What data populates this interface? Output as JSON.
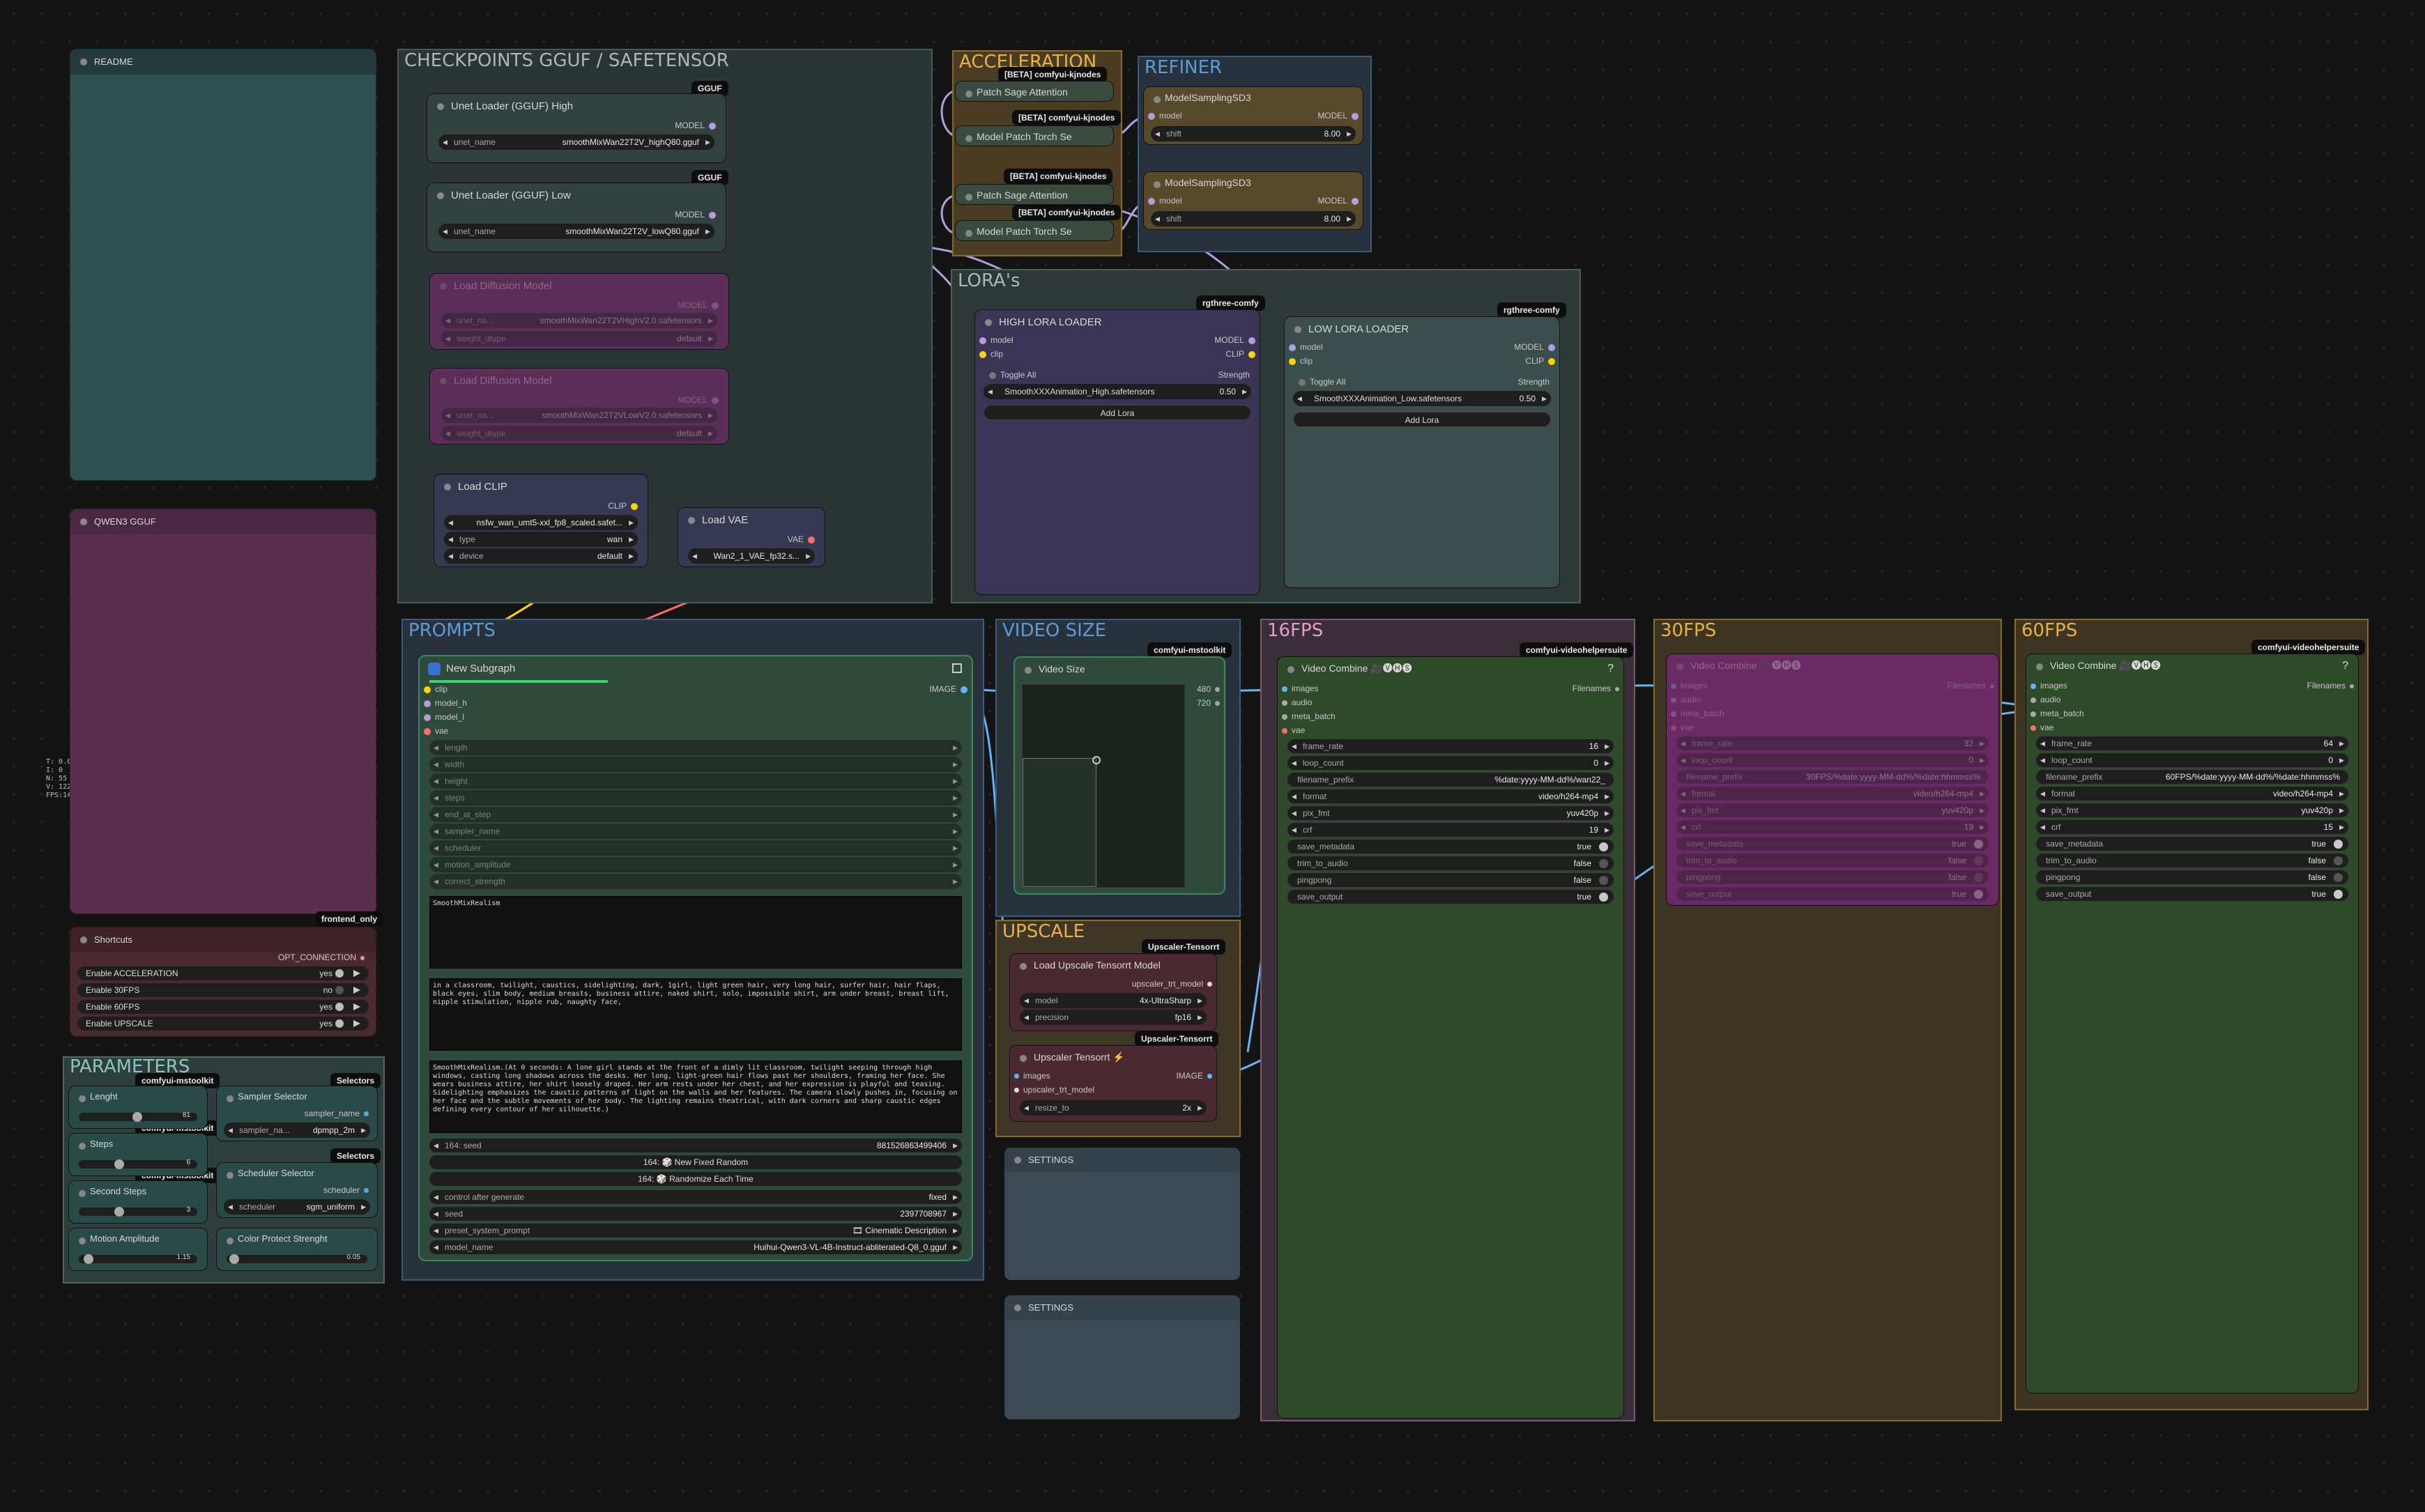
{
  "groups": {
    "readme": "README",
    "qwen": "QWEN3  GGUF",
    "checkpoints": "CHECKPOINTS    GGUF / SAFETENSOR",
    "acceleration": "ACCELERATION",
    "refiner": "REFINER",
    "lora": "LORA's",
    "prompts": "PROMPTS",
    "video_size": "VIDEO SIZE",
    "fps16": "16FPS",
    "fps30": "30FPS",
    "fps60": "60FPS",
    "upscale": "UPSCALE",
    "parameters": "PARAMETERS"
  },
  "stats": [
    "T: 0.00s",
    "I: 0",
    "N: 55 [",
    "V: 122",
    "FPS:14"
  ],
  "badges": {
    "gguf": "GGUF",
    "kjnodes": "[BETA] comfyui-kjnodes",
    "rgthree": "rgthree-comfy",
    "mstoolkit": "comfyui-mstoolkit",
    "videohelper": "comfyui-videohelpersuite",
    "upscaler": "Upscaler-Tensorrt",
    "frontend": "frontend_only",
    "selectors": "Selectors"
  },
  "unet_high": {
    "title": "Unet Loader (GGUF) High",
    "out": "MODEL",
    "w_label": "unet_name",
    "w_value": "smoothMixWan22T2V_highQ80.gguf"
  },
  "unet_low": {
    "title": "Unet Loader (GGUF) Low",
    "out": "MODEL",
    "w_label": "unet_name",
    "w_value": "smoothMixWan22T2V_lowQ80.gguf"
  },
  "diff1": {
    "title": "Load Diffusion Model",
    "out": "MODEL",
    "w1_label": "unet_na...",
    "w1_value": "smoothMixWan22T2VHighV2.0.safetensors",
    "w2_label": "weight_dtype",
    "w2_value": "default"
  },
  "diff2": {
    "title": "Load Diffusion Model",
    "out": "MODEL",
    "w1_label": "unet_na...",
    "w1_value": "smoothMixWan22T2VLowV2.0.safetensors",
    "w2_label": "weight_dtype",
    "w2_value": "default"
  },
  "clip": {
    "title": "Load CLIP",
    "out": "CLIP",
    "w1_value": "nsfw_wan_umt5-xxl_fp8_scaled.safet...",
    "w2_label": "type",
    "w2_value": "wan",
    "w3_label": "device",
    "w3_value": "default"
  },
  "vae": {
    "title": "Load VAE",
    "out": "VAE",
    "w_value": "Wan2_1_VAE_fp32.s..."
  },
  "accel": {
    "patch1": "Patch Sage Attention",
    "torch1": "Model Patch Torch Se",
    "patch2": "Patch Sage Attention",
    "torch2": "Model Patch Torch Se"
  },
  "refiner": {
    "title": "ModelSamplingSD3",
    "in": "model",
    "out": "MODEL",
    "shift_label": "shift",
    "shift_value": "8.00"
  },
  "high_lora": {
    "title": "HIGH LORA LOADER",
    "in1": "model",
    "in2": "clip",
    "out1": "MODEL",
    "out2": "CLIP",
    "toggle": "Toggle All",
    "strength": "Strength",
    "lora": "SmoothXXXAnimation_High.safetensors",
    "lora_val": "0.50",
    "add": "Add Lora"
  },
  "low_lora": {
    "title": "LOW LORA LOADER",
    "in1": "model",
    "in2": "clip",
    "out1": "MODEL",
    "out2": "CLIP",
    "toggle": "Toggle All",
    "strength": "Strength",
    "lora": "SmoothXXXAnimation_Low.safetensors",
    "lora_val": "0.50",
    "add": "Add Lora"
  },
  "subgraph": {
    "title": "New Subgraph",
    "out": "IMAGE",
    "inputs": [
      "clip",
      "model_h",
      "model_l",
      "vae"
    ],
    "widgets": [
      "length",
      "width",
      "height",
      "steps",
      "end_at_step",
      "sampler_name",
      "scheduler",
      "motion_amplitude",
      "correct_strength"
    ],
    "text1": "SmoothMixRealism",
    "text2": "in a classroom, twilight, caustics, sidelighting, dark, 1girl, light green hair, very long hair, surfer hair, hair flaps, black eyes, slim body, medium breasts, business attire, naked shirt, solo, impossible shirt, arm under breast, breast lift, nipple stimulation, nipple rub, naughty face,",
    "text3": "SmoothMixRealism.(At 0 seconds: A lone girl stands at the front of a dimly lit classroom, twilight seeping through high windows, casting long shadows across the desks. Her long, light-green hair flows past her shoulders, framing her face. She wears business attire, her shirt loosely draped. Her arm rests under her chest, and her expression is playful and teasing. Sidelighting emphasizes the caustic patterns of light on the walls and her features. The camera slowly pushes in, focusing on her face and the subtle movements of her body. The lighting remains theatrical, with dark corners and sharp caustic edges defining every contour of her silhouette.)",
    "seed_label": "164: seed",
    "seed_value": "881526863499406",
    "btn_fixed": "164: 🎲 New Fixed Random",
    "btn_random": "164: 🎲 Randomize Each Time",
    "control_label": "control after generate",
    "control_value": "fixed",
    "seed2_label": "seed",
    "seed2_value": "2397708967",
    "preset_label": "preset_system_prompt",
    "preset_value": "🎞 Cinematic Description",
    "model_label": "model_name",
    "model_value": "Huihui-Qwen3-VL-4B-Instruct-abliterated-Q8_0.gguf"
  },
  "video_size": {
    "title": "Video Size",
    "v1": "480",
    "v2": "720"
  },
  "upscale": {
    "loader_title": "Load Upscale Tensorrt Model",
    "loader_out": "upscaler_trt_model",
    "model_label": "model",
    "model_value": "4x-UltraSharp",
    "precision_label": "precision",
    "precision_value": "fp16",
    "up_title": "Upscaler Tensorrt ⚡",
    "up_in1": "images",
    "up_in2": "upscaler_trt_model",
    "up_out": "IMAGE",
    "resize_label": "resize_to",
    "resize_value": "2x"
  },
  "settings": [
    "SETTINGS",
    "SETTINGS"
  ],
  "vc16": {
    "title": "Video Combine 🎥🅥🅗🅢",
    "inputs": [
      "images",
      "audio",
      "meta_batch",
      "vae"
    ],
    "out": "Filenames",
    "rows": [
      {
        "k": "frame_rate",
        "v": "16",
        "t": false
      },
      {
        "k": "loop_count",
        "v": "0",
        "t": false
      },
      {
        "k": "filename_prefix",
        "v": "%date:yyyy-MM-dd%/wan22_",
        "t": false
      },
      {
        "k": "format",
        "v": "video/h264-mp4",
        "t": false
      },
      {
        "k": "pix_fmt",
        "v": "yuv420p",
        "t": false
      },
      {
        "k": "crf",
        "v": "19",
        "t": false
      },
      {
        "k": "save_metadata",
        "v": "true",
        "t": true
      },
      {
        "k": "trim_to_audio",
        "v": "false",
        "t": true
      },
      {
        "k": "pingpong",
        "v": "false",
        "t": true
      },
      {
        "k": "save_output",
        "v": "true",
        "t": true
      }
    ]
  },
  "vc30": {
    "title": "Video Combine 🎥🅥🅗🅢",
    "inputs": [
      "images",
      "audio",
      "meta_batch",
      "vae"
    ],
    "out": "Filenames",
    "rows": [
      {
        "k": "frame_rate",
        "v": "32",
        "t": false
      },
      {
        "k": "loop_count",
        "v": "0",
        "t": false
      },
      {
        "k": "filename_prefix",
        "v": "30FPS/%date:yyyy-MM-dd%/%date:hhmmss%",
        "t": false
      },
      {
        "k": "format",
        "v": "video/h264-mp4",
        "t": false
      },
      {
        "k": "pix_fmt",
        "v": "yuv420p",
        "t": false
      },
      {
        "k": "crf",
        "v": "19",
        "t": false
      },
      {
        "k": "save_metadata",
        "v": "true",
        "t": true
      },
      {
        "k": "trim_to_audio",
        "v": "false",
        "t": true
      },
      {
        "k": "pingpong",
        "v": "false",
        "t": true
      },
      {
        "k": "save_output",
        "v": "true",
        "t": true
      }
    ]
  },
  "vc60": {
    "title": "Video Combine 🎥🅥🅗🅢",
    "inputs": [
      "images",
      "audio",
      "meta_batch",
      "vae"
    ],
    "out": "Filenames",
    "rows": [
      {
        "k": "frame_rate",
        "v": "64",
        "t": false
      },
      {
        "k": "loop_count",
        "v": "0",
        "t": false
      },
      {
        "k": "filename_prefix",
        "v": "60FPS/%date:yyyy-MM-dd%/%date:hhmmss%",
        "t": false
      },
      {
        "k": "format",
        "v": "video/h264-mp4",
        "t": false
      },
      {
        "k": "pix_fmt",
        "v": "yuv420p",
        "t": false
      },
      {
        "k": "crf",
        "v": "15",
        "t": false
      },
      {
        "k": "save_metadata",
        "v": "true",
        "t": true
      },
      {
        "k": "trim_to_audio",
        "v": "false",
        "t": true
      },
      {
        "k": "pingpong",
        "v": "false",
        "t": true
      },
      {
        "k": "save_output",
        "v": "true",
        "t": true
      }
    ]
  },
  "shortcuts": {
    "title": "Shortcuts",
    "out": "OPT_CONNECTION",
    "rows": [
      {
        "k": "Enable ACCELERATION",
        "v": "yes"
      },
      {
        "k": "Enable 30FPS",
        "v": "no"
      },
      {
        "k": "Enable 60FPS",
        "v": "yes"
      },
      {
        "k": "Enable UPSCALE",
        "v": "yes"
      }
    ]
  },
  "params": {
    "length": {
      "title": "Lenght",
      "value": "81",
      "level": 0.45
    },
    "steps": {
      "title": "Steps",
      "value": "6",
      "level": 0.3
    },
    "second_steps": {
      "title": "Second Steps",
      "value": "3",
      "level": 0.3
    },
    "motion": {
      "title": "Motion Amplitude",
      "value": "1.15",
      "level": 0.1
    },
    "sampler": {
      "title": "Sampler Selector",
      "out": "sampler_name",
      "w_label": "sampler_na...",
      "w_value": "dpmpp_2m"
    },
    "scheduler": {
      "title": "Scheduler Selector",
      "out": "scheduler",
      "w_label": "scheduler",
      "w_value": "sgm_uniform"
    },
    "color": {
      "title": "Color Protect Strenght",
      "value": "0.05",
      "level": 0.05
    }
  },
  "colors": {
    "wire_model": "#b39ddb",
    "wire_image": "#64b5f6",
    "wire_clip": "#ffd500",
    "wire_vae": "#ff6e6e"
  }
}
